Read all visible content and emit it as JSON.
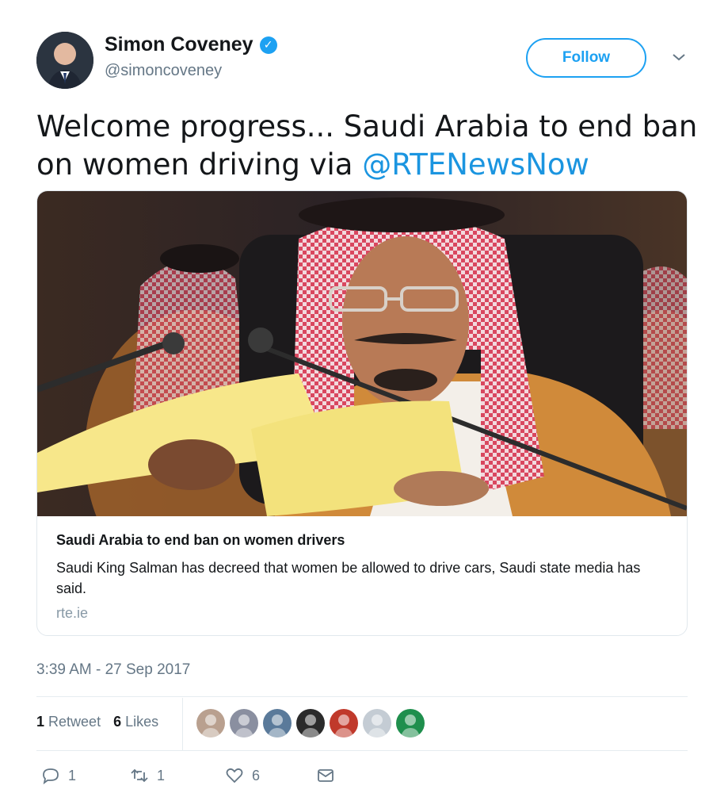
{
  "author": {
    "name": "Simon Coveney",
    "handle": "@simoncoveney",
    "verified": true
  },
  "follow_label": "Follow",
  "tweet": {
    "text": "Welcome progress... Saudi Arabia to end ban on women driving via",
    "mention": "@RTENewsNow"
  },
  "card": {
    "title": "Saudi Arabia to end ban on women drivers",
    "description": "Saudi King Salman  has decreed that women be allowed to drive cars, Saudi state media has said.",
    "domain": "rte.ie"
  },
  "timestamp": "3:39 AM - 27 Sep 2017",
  "stats": {
    "retweets_count": "1",
    "retweets_label": "Retweet",
    "likes_count": "6",
    "likes_label": "Likes"
  },
  "likers": [
    {
      "color": "#b9a08f"
    },
    {
      "color": "#8a8fa0"
    },
    {
      "color": "#5a7a9a"
    },
    {
      "color": "#2b2b2b"
    },
    {
      "color": "#c0392b"
    },
    {
      "color": "#c4ccd4"
    },
    {
      "color": "#1f8f4d"
    }
  ],
  "actions": {
    "reply_count": "1",
    "retweet_count": "1",
    "like_count": "6"
  },
  "colors": {
    "accent": "#1da1f2",
    "mention": "#1b95e0",
    "muted": "#657786"
  }
}
